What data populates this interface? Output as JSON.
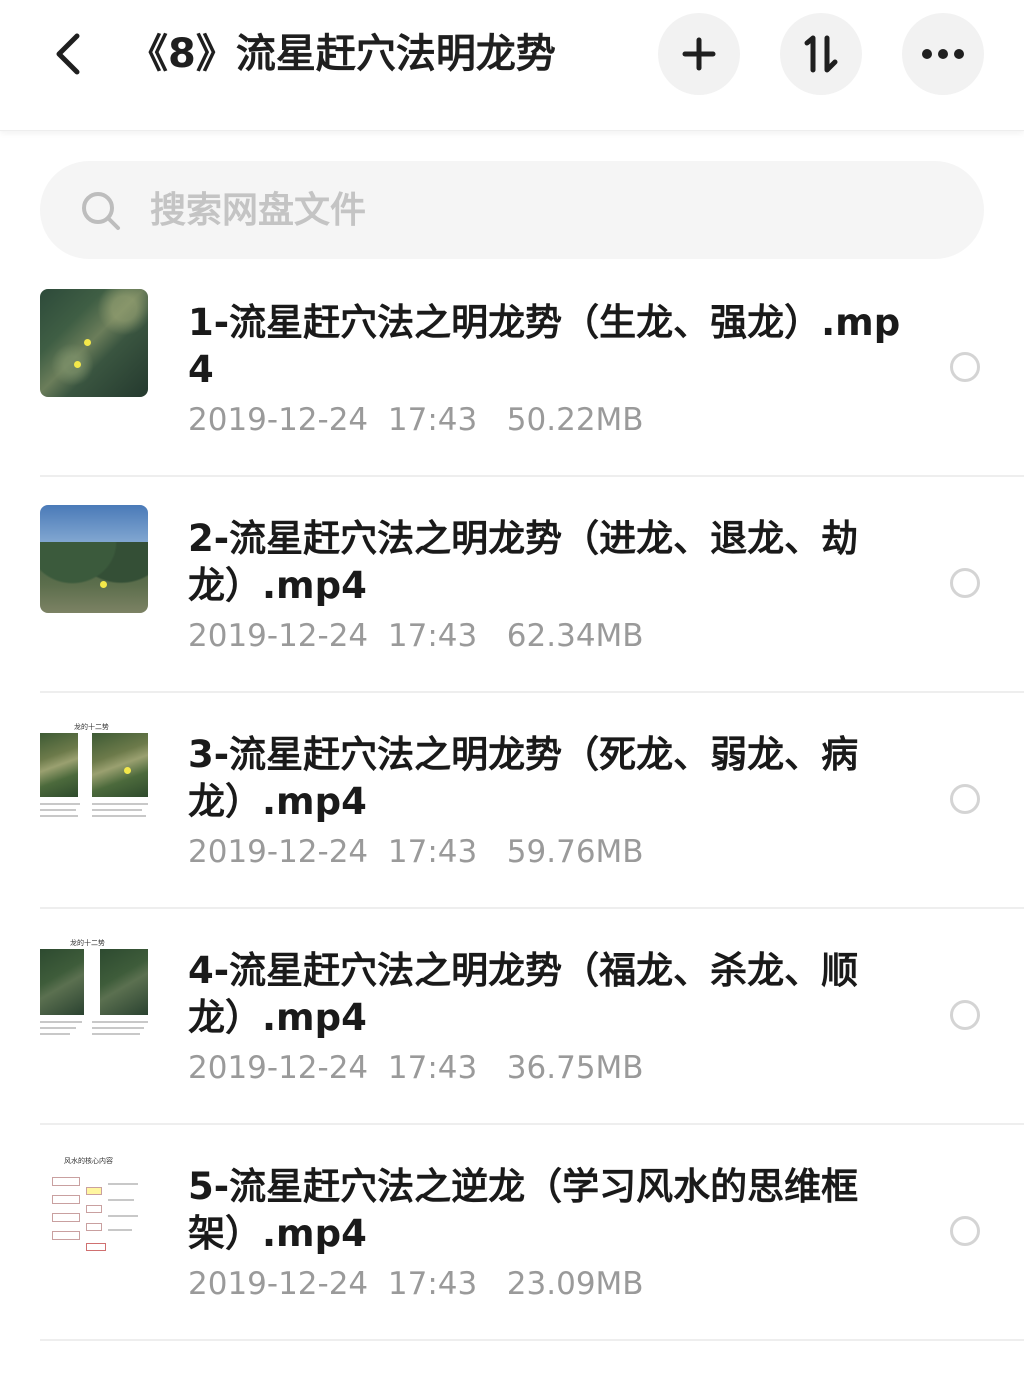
{
  "header": {
    "title": "《8》流星赶穴法明龙势",
    "back_icon": "chevron-left-icon",
    "add_icon": "plus-icon",
    "sort_icon": "sort-icon",
    "more_icon": "more-horizontal-icon"
  },
  "search": {
    "placeholder": "搜索网盘文件",
    "icon": "search-icon"
  },
  "colors": {
    "title": "#1f1f1f",
    "meta": "#9a9a9a",
    "placeholder": "#c4c4c4",
    "button_bg": "#f2f2f2",
    "search_bg": "#f5f5f5",
    "divider": "#eeeeee"
  },
  "files": [
    {
      "name": "1-流星赶穴法之明龙势（生龙、强龙）.mp4",
      "date": "2019-12-24",
      "time": "17:43",
      "size": "50.22MB",
      "thumbnail": "aerial-map-thumbnail"
    },
    {
      "name": "2-流星赶穴法之明龙势（进龙、退龙、劫龙）.mp4",
      "date": "2019-12-24",
      "time": "17:43",
      "size": "62.34MB",
      "thumbnail": "mountain-landscape-thumbnail"
    },
    {
      "name": "3-流星赶穴法之明龙势（死龙、弱龙、病龙）.mp4",
      "date": "2019-12-24",
      "time": "17:43",
      "size": "59.76MB",
      "thumbnail": "slide-thumbnail",
      "thumbnail_caption": "龙的十二势"
    },
    {
      "name": "4-流星赶穴法之明龙势（福龙、杀龙、顺龙）.mp4",
      "date": "2019-12-24",
      "time": "17:43",
      "size": "36.75MB",
      "thumbnail": "slide-thumbnail",
      "thumbnail_caption": "龙的十二势"
    },
    {
      "name": "5-流星赶穴法之逆龙（学习风水的思维框架）.mp4",
      "date": "2019-12-24",
      "time": "17:43",
      "size": "23.09MB",
      "thumbnail": "diagram-slide-thumbnail",
      "thumbnail_caption": "风水的核心内容"
    }
  ]
}
